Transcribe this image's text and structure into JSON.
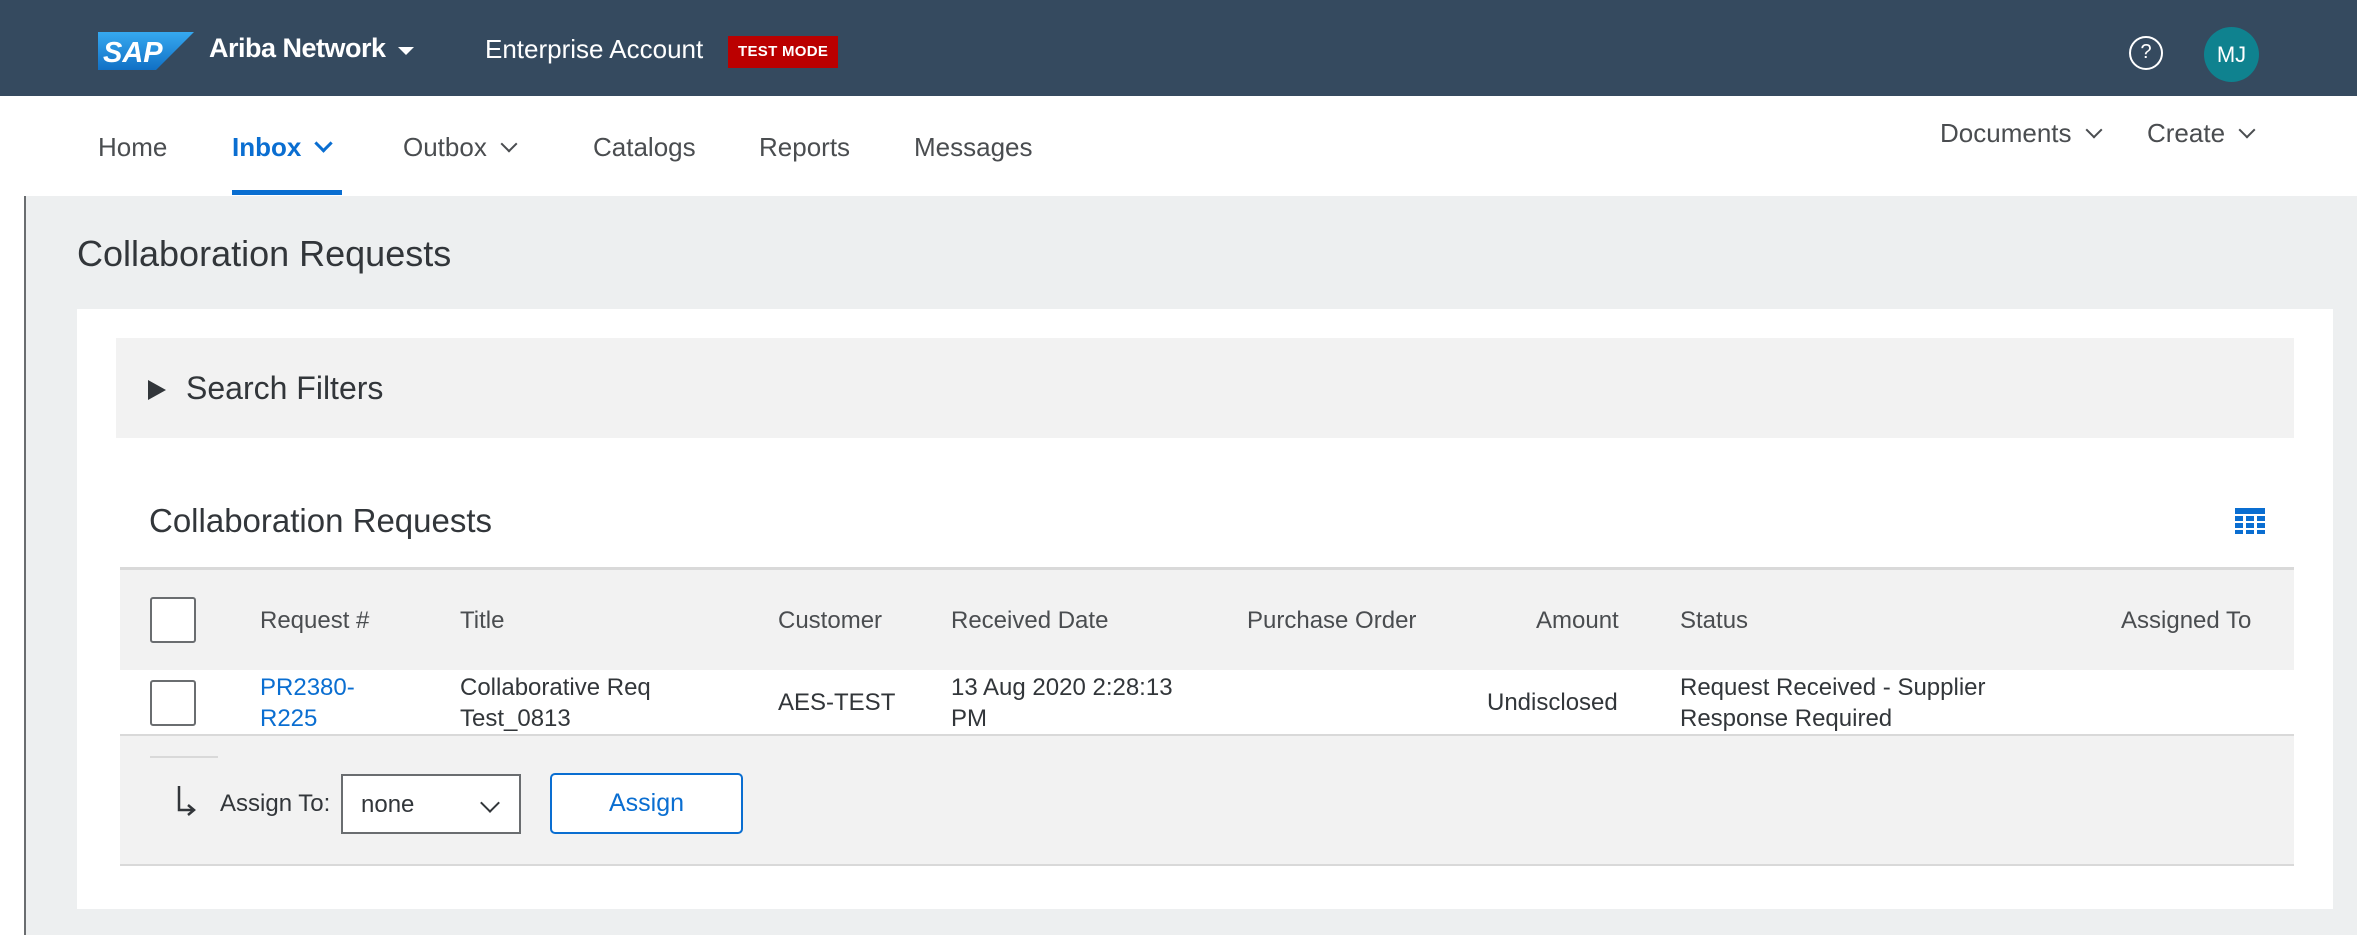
{
  "shell": {
    "logo_text": "SAP",
    "network_label": "Ariba Network",
    "account_label": "Enterprise Account",
    "test_mode_badge": "TEST MODE",
    "help_glyph": "?",
    "avatar_initials": "MJ",
    "colors": {
      "shell_bg": "#354a5f",
      "badge_bg": "#bb0000",
      "avatar_bg": "#0f828f",
      "logo_blue": "#1f8ad8"
    }
  },
  "nav": {
    "items": [
      {
        "label": "Home"
      },
      {
        "label": "Inbox",
        "active": true
      },
      {
        "label": "Outbox"
      },
      {
        "label": "Catalogs"
      },
      {
        "label": "Reports"
      },
      {
        "label": "Messages"
      }
    ],
    "right": [
      {
        "label": "Documents"
      },
      {
        "label": "Create"
      }
    ],
    "accent_color": "#0a6ed1"
  },
  "page": {
    "title": "Collaboration Requests"
  },
  "filters": {
    "label": "Search Filters"
  },
  "section": {
    "title": "Collaboration Requests",
    "settings_icon": "table-settings-icon"
  },
  "table": {
    "columns": [
      "Request #",
      "Title",
      "Customer",
      "Received Date",
      "Purchase Order",
      "Amount",
      "Status",
      "Assigned To"
    ],
    "rows": [
      {
        "request_line1": "PR2380-",
        "request_line2": "R225",
        "title_line1": "Collaborative Req",
        "title_line2": "Test_0813",
        "customer": "AES-TEST",
        "received_line1": "13 Aug 2020 2:28:13",
        "received_line2": "PM",
        "purchase_order": "",
        "amount": "Undisclosed",
        "status_line1": "Request Received - Supplier",
        "status_line2": "Response Required",
        "assigned_to": ""
      }
    ]
  },
  "assign": {
    "label": "Assign To:",
    "selected": "none",
    "button_label": "Assign"
  }
}
